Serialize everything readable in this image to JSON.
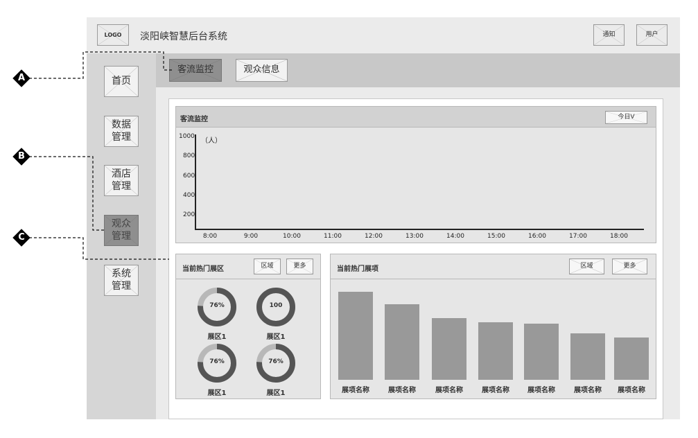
{
  "header": {
    "logo": "LOGO",
    "title": "淡阳峡智慧后台系统",
    "notify_button": "通知",
    "user_button": "用户"
  },
  "top_tabs": [
    {
      "label": "客流监控",
      "active": true
    },
    {
      "label": "观众信息",
      "active": false
    }
  ],
  "sidebar": {
    "items": [
      {
        "label": "首页",
        "active": false
      },
      {
        "label": "数据\n管理",
        "active": false
      },
      {
        "label": "酒店\n管理",
        "active": false
      },
      {
        "label": "观众\n管理",
        "active": true
      },
      {
        "label": "系统\n管理",
        "active": false
      }
    ]
  },
  "annotations": [
    "A",
    "B",
    "C"
  ],
  "traffic_panel": {
    "title": "客流监控",
    "dropdown": "今日V"
  },
  "chart_data": {
    "type": "line",
    "x": [
      "8:00",
      "9:00",
      "10:00",
      "11:00",
      "12:00",
      "13:00",
      "14:00",
      "15:00",
      "16:00",
      "17:00",
      "18:00"
    ],
    "y_ticks": [
      1000,
      800,
      600,
      400,
      200
    ],
    "y_unit": "（人）",
    "ylim": [
      0,
      1000
    ],
    "series": []
  },
  "hot_zones": {
    "title": "当前热门展区",
    "region_button": "区域",
    "more_button": "更多",
    "items": [
      {
        "value": 0.76,
        "text": "76%",
        "label": "展区1"
      },
      {
        "value": 1.0,
        "text": "100",
        "label": "展区1"
      },
      {
        "value": 0.76,
        "text": "76%",
        "label": "展区1"
      },
      {
        "value": 0.76,
        "text": "76%",
        "label": "展区1"
      }
    ]
  },
  "hot_items": {
    "title": "当前热门展项",
    "region_button": "区域",
    "more_button": "更多",
    "bars": [
      {
        "label": "展项名称",
        "value": 1.0
      },
      {
        "label": "展项名称",
        "value": 0.86
      },
      {
        "label": "展项名称",
        "value": 0.7
      },
      {
        "label": "展项名称",
        "value": 0.65
      },
      {
        "label": "展项名称",
        "value": 0.64
      },
      {
        "label": "展项名称",
        "value": 0.53
      },
      {
        "label": "展项名称",
        "value": 0.48
      }
    ]
  }
}
